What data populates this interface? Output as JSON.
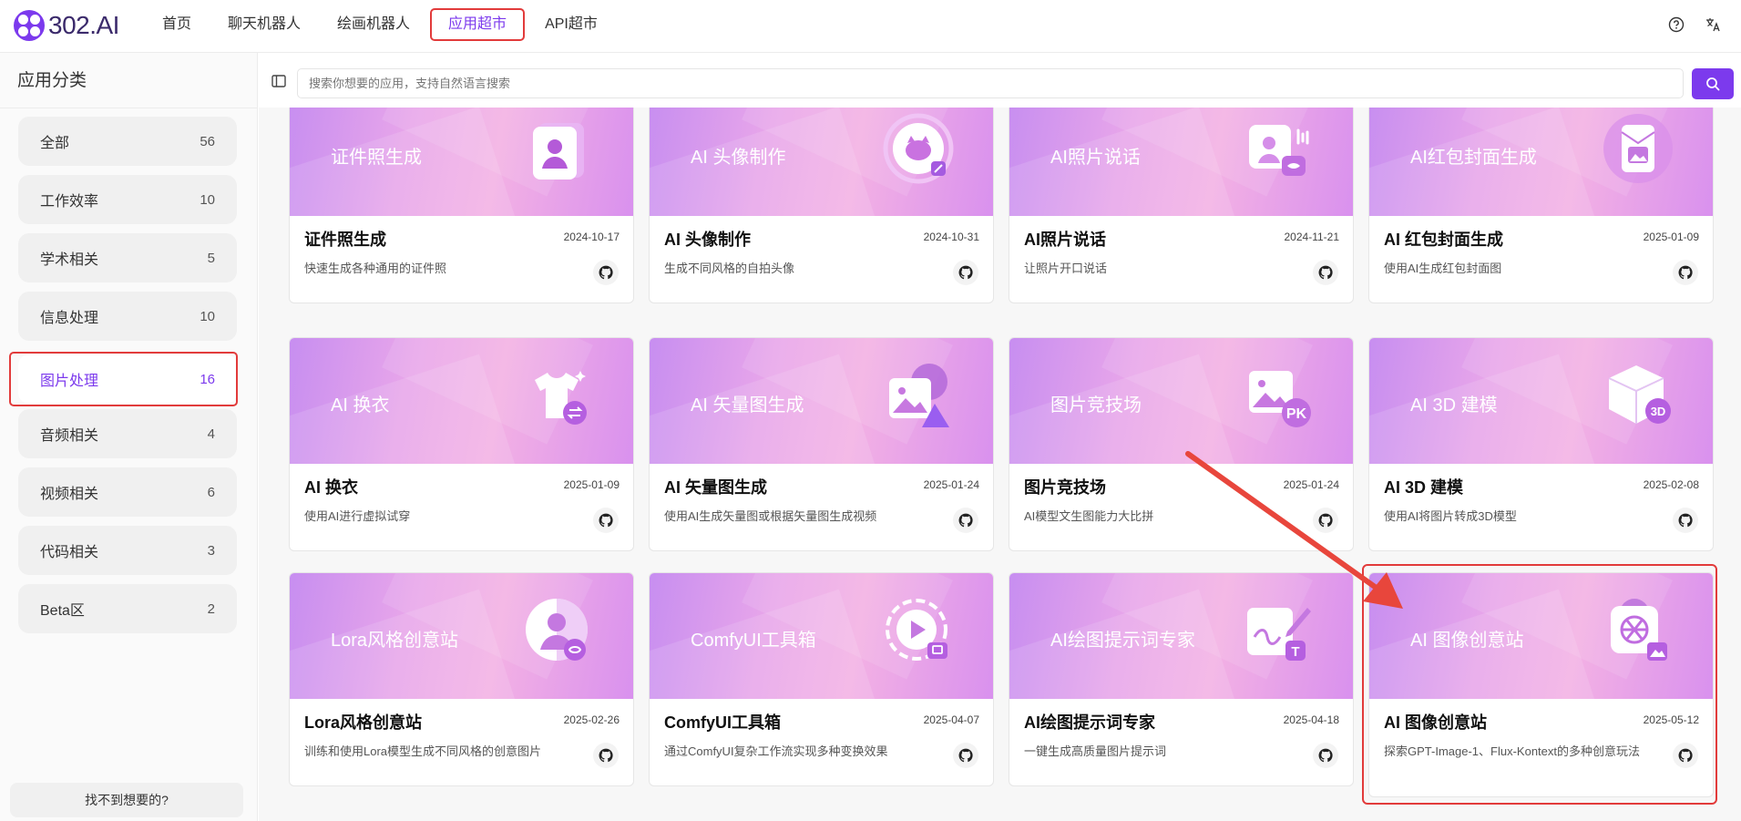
{
  "app": {
    "logo_text": "302.AI"
  },
  "nav": {
    "items": [
      "首页",
      "聊天机器人",
      "绘画机器人",
      "应用超市",
      "API超市"
    ],
    "active_index": 3
  },
  "sidebar": {
    "title": "应用分类",
    "categories": [
      {
        "label": "全部",
        "count": "56"
      },
      {
        "label": "工作效率",
        "count": "10"
      },
      {
        "label": "学术相关",
        "count": "5"
      },
      {
        "label": "信息处理",
        "count": "10"
      },
      {
        "label": "图片处理",
        "count": "16"
      },
      {
        "label": "音频相关",
        "count": "4"
      },
      {
        "label": "视频相关",
        "count": "6"
      },
      {
        "label": "代码相关",
        "count": "3"
      },
      {
        "label": "Beta区",
        "count": "2"
      }
    ],
    "active_index": 4,
    "feedback_label": "找不到想要的?"
  },
  "search": {
    "placeholder": "搜索你想要的应用，支持自然语言搜索"
  },
  "cards": [
    {
      "banner": "证件照生成",
      "title": "证件照生成",
      "date": "2024-10-17",
      "desc": "快速生成各种通用的证件照",
      "icon": "id-photo-icon"
    },
    {
      "banner": "AI 头像制作",
      "title": "AI 头像制作",
      "date": "2024-10-31",
      "desc": "生成不同风格的自拍头像",
      "icon": "avatar-icon"
    },
    {
      "banner": "AI照片说话",
      "title": "AI照片说话",
      "date": "2024-11-21",
      "desc": "让照片开口说话",
      "icon": "talking-photo-icon"
    },
    {
      "banner": "AI红包封面生成",
      "title": "AI 红包封面生成",
      "date": "2025-01-09",
      "desc": "使用AI生成红包封面图",
      "icon": "red-packet-icon"
    },
    {
      "banner": "AI 换衣",
      "title": "AI 换衣",
      "date": "2025-01-09",
      "desc": "使用AI进行虚拟试穿",
      "icon": "tshirt-swap-icon"
    },
    {
      "banner": "AI 矢量图生成",
      "title": "AI 矢量图生成",
      "date": "2025-01-24",
      "desc": "使用AI生成矢量图或根据矢量图生成视频",
      "icon": "vector-image-icon"
    },
    {
      "banner": "图片竞技场",
      "title": "图片竞技场",
      "date": "2025-01-24",
      "desc": "AI模型文生图能力大比拼",
      "icon": "image-pk-icon"
    },
    {
      "banner": "AI 3D 建模",
      "title": "AI 3D 建模",
      "date": "2025-02-08",
      "desc": "使用AI将图片转成3D模型",
      "icon": "cube-3d-icon"
    },
    {
      "banner": "Lora风格创意站",
      "title": "Lora风格创意站",
      "date": "2025-02-26",
      "desc": "训练和使用Lora模型生成不同风格的创意图片",
      "icon": "lora-user-icon"
    },
    {
      "banner": "ComfyUI工具箱",
      "title": "ComfyUI工具箱",
      "date": "2025-04-07",
      "desc": "通过ComfyUI复杂工作流实现多种变换效果",
      "icon": "comfyui-play-icon"
    },
    {
      "banner": "AI绘图提示词专家",
      "title": "AI绘图提示词专家",
      "date": "2025-04-18",
      "desc": "一键生成高质量图片提示词",
      "icon": "prompt-pen-icon"
    },
    {
      "banner": "AI 图像创意站",
      "title": "AI 图像创意站",
      "date": "2025-05-12",
      "desc": "探索GPT-Image-1、Flux-Kontext的多种创意玩法",
      "icon": "openai-image-icon"
    }
  ],
  "colors": {
    "accent": "#7c3aed",
    "highlight": "#e23b3b"
  }
}
